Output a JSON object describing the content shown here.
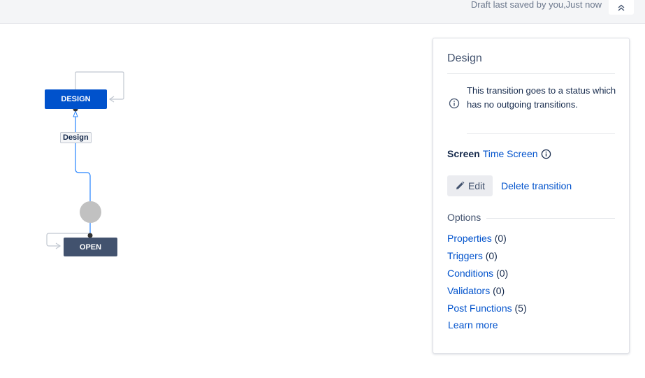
{
  "header": {
    "draft_status": "Draft last saved by you,Just now",
    "collapse_icon": "double-chevron-up-icon"
  },
  "workflow": {
    "statuses": [
      {
        "name": "DESIGN",
        "color": "#0052cc"
      },
      {
        "name": "OPEN",
        "color": "#42526e"
      }
    ],
    "transition_label": "Design"
  },
  "panel": {
    "title": "Design",
    "info_message": "This transition goes to a status which has no outgoing transitions.",
    "screen_label": "Screen",
    "screen_value": "Time Screen",
    "edit_label": "Edit",
    "delete_label": "Delete transition",
    "options_label": "Options",
    "options": [
      {
        "name": "Properties",
        "count": " (0)"
      },
      {
        "name": "Triggers",
        "count": " (0)"
      },
      {
        "name": "Conditions",
        "count": " (0)"
      },
      {
        "name": "Validators",
        "count": " (0)"
      },
      {
        "name": "Post Functions",
        "count": " (5)"
      }
    ],
    "learn_more": "Learn more"
  },
  "colors": {
    "link": "#0052cc",
    "primary_status": "#0052cc",
    "secondary_status": "#42526e",
    "initial_node": "#c1c1c1"
  }
}
